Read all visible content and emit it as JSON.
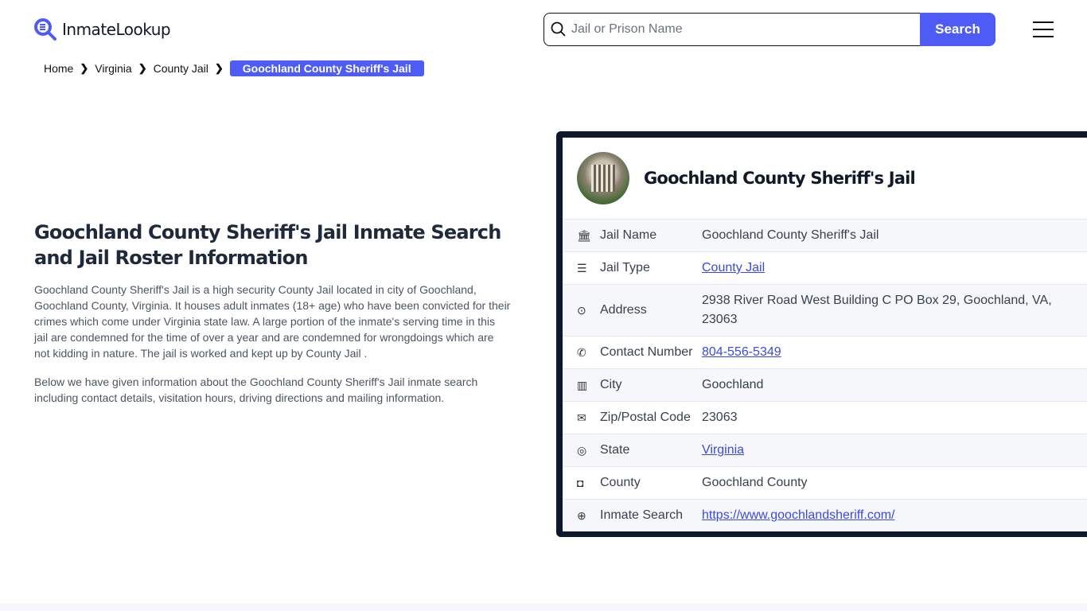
{
  "header": {
    "logo": "InmateLookup",
    "search_placeholder": "Jail or Prison Name",
    "search_button": "Search"
  },
  "breadcrumb": [
    "Home",
    "Virginia",
    "County Jail",
    "Goochland County Sheriff's Jail"
  ],
  "main": {
    "title": "Goochland County Sheriff's Jail Inmate Search and Jail Roster Information",
    "paragraphs": [
      "Goochland County Sheriff's Jail is a high security County Jail located in city of Goochland, Goochland County, Virginia. It houses adult inmates (18+ age) who have been convicted for their crimes which come under Virginia state law. A large portion of the inmate's serving time in this jail are condemned for the time of over a year and are condemned for wrongdoings which are not kidding in nature. The jail is worked and kept up by County Jail .",
      "Below we have given information about the Goochland County Sheriff's Jail inmate search including contact details, visitation hours, driving directions and mailing information."
    ]
  },
  "card": {
    "title": "Goochland County Sheriff's Jail",
    "rows": [
      {
        "icon": "bank-icon",
        "label": "Jail Name",
        "value": "Goochland County Sheriff's Jail",
        "link": false
      },
      {
        "icon": "list-icon",
        "label": "Jail Type",
        "value": "County Jail",
        "link": true
      },
      {
        "icon": "map-pin-icon",
        "label": "Address",
        "value": "2938 River Road West Building C PO Box 29, Goochland, VA, 23063",
        "link": false
      },
      {
        "icon": "phone-icon",
        "label": "Contact Number",
        "value": "804-556-5349",
        "link": true
      },
      {
        "icon": "map-icon",
        "label": "City",
        "value": "Goochland",
        "link": false
      },
      {
        "icon": "mail-icon",
        "label": "Zip/Postal Code",
        "value": "23063",
        "link": false
      },
      {
        "icon": "globe-icon",
        "label": "State",
        "value": "Virginia",
        "link": true
      },
      {
        "icon": "badge-icon",
        "label": "County",
        "value": "Goochland County",
        "link": false
      },
      {
        "icon": "web-icon",
        "label": "Inmate Search",
        "value": "https://www.goochlandsheriff.com/",
        "link": true
      }
    ]
  },
  "colors": {
    "accent": "#4f5bf5",
    "card_border": "#0f172a",
    "link": "#3b49df"
  }
}
